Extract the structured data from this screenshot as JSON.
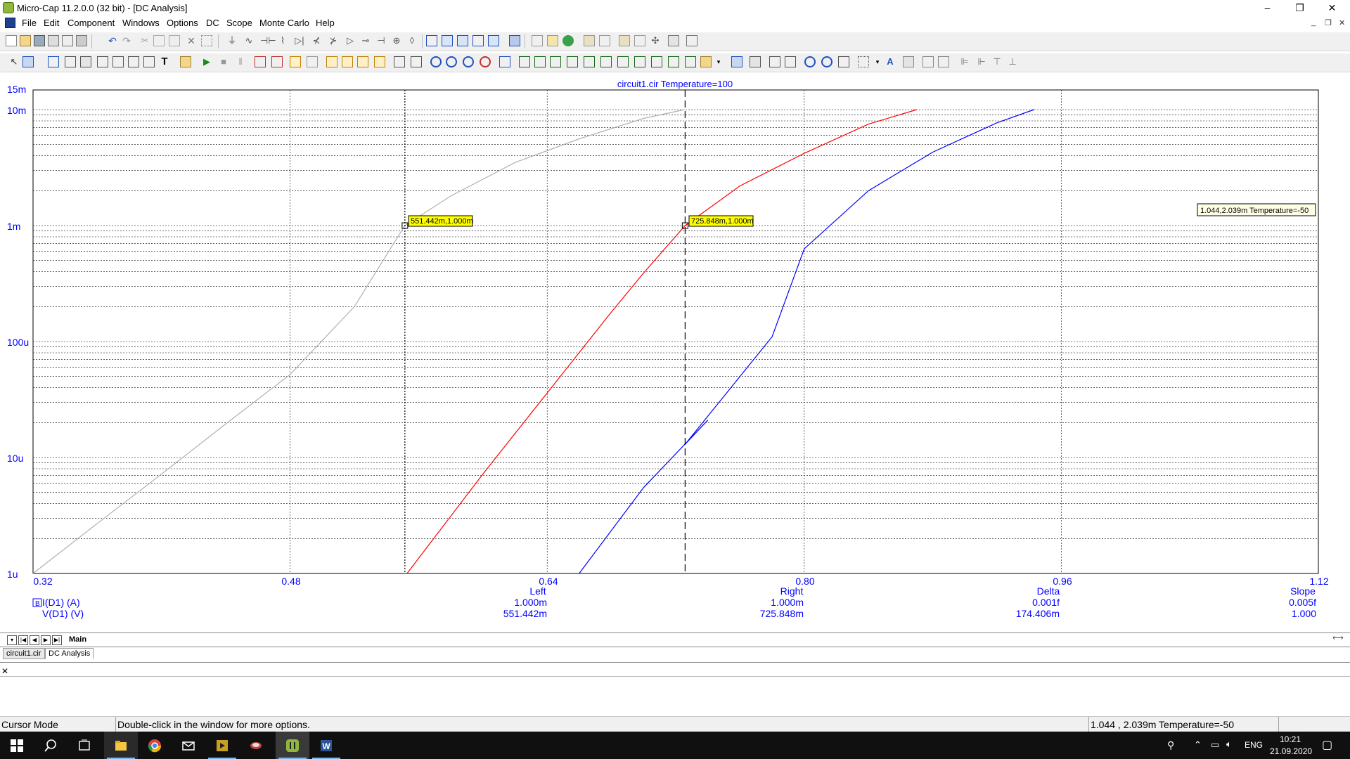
{
  "window": {
    "title": "Micro-Cap 11.2.0.0 (32 bit) - [DC Analysis]",
    "controls": [
      "–",
      "❐",
      "✕"
    ],
    "mdi_controls": [
      "_",
      "❐",
      "✕"
    ]
  },
  "menu": {
    "items": [
      "File",
      "Edit",
      "Component",
      "Windows",
      "Options",
      "DC",
      "Scope",
      "Monte Carlo",
      "Help"
    ]
  },
  "plot": {
    "title": "circuit1.cir Temperature=100",
    "y_ticks": [
      "15m",
      "10m",
      "1m",
      "100u",
      "10u",
      "1u"
    ],
    "x_ticks": [
      "0.32",
      "0.48",
      "0.64",
      "0.80",
      "0.96",
      "1.12"
    ],
    "cursor_left_label": "551.442m,1.000m",
    "cursor_right_label": "725.848m,1.000m",
    "tooltip": "1.044,2.039m Temperature=-50",
    "colors": {
      "axis_text": "#0000ff",
      "grid": "#000000",
      "label_bg": "#ffff00"
    }
  },
  "chart_data": {
    "type": "line",
    "title": "circuit1.cir Temperature=100",
    "xlabel": "V(D1) (V)",
    "ylabel": "I(D1) (A)",
    "y_scale": "log",
    "xlim": [
      0.32,
      1.12
    ],
    "ylim": [
      1e-06,
      0.015
    ],
    "x_ticks": [
      0.32,
      0.48,
      0.64,
      0.8,
      0.96,
      1.12
    ],
    "y_ticks": [
      1e-06,
      1e-05,
      0.0001,
      0.001,
      0.01,
      0.015
    ],
    "series": [
      {
        "color": "#b0b0b0",
        "x": [
          0.32,
          0.36,
          0.4,
          0.44,
          0.48,
          0.52,
          0.5514,
          0.58,
          0.62,
          0.66,
          0.7,
          0.7254
        ],
        "y": [
          1e-06,
          2.7e-06,
          7.2e-06,
          1.95e-05,
          5.2e-05,
          0.0002,
          0.001,
          0.0018,
          0.0035,
          0.0056,
          0.0084,
          0.01
        ]
      },
      {
        "color": "#ff0000",
        "x": [
          0.5528,
          0.6,
          0.64,
          0.68,
          0.7,
          0.725848,
          0.76,
          0.8,
          0.84,
          0.87
        ],
        "y": [
          1e-06,
          7.2e-06,
          3.6e-05,
          0.00018,
          0.00039,
          0.001,
          0.0022,
          0.0042,
          0.0075,
          0.01
        ]
      },
      {
        "color": "#0000ff",
        "x": [
          0.6599,
          0.7,
          0.74,
          0.7258,
          0.78,
          0.8,
          0.84,
          0.88,
          0.92,
          0.943
        ],
        "y": [
          1e-06,
          5.5e-06,
          2.1e-05,
          1.3e-05,
          0.00011,
          0.00063,
          0.002,
          0.0043,
          0.0077,
          0.01
        ]
      }
    ],
    "cursors": [
      {
        "name": "Left",
        "x": 0.551442,
        "style": "dotted"
      },
      {
        "name": "Right",
        "x": 0.725848,
        "style": "dashed"
      }
    ]
  },
  "readout": {
    "expr1": "I(D1) (A)",
    "expr2": "V(D1) (V)",
    "cols": [
      {
        "head": "Left",
        "v1": "1.000m",
        "v2": "551.442m"
      },
      {
        "head": "Right",
        "v1": "1.000m",
        "v2": "725.848m"
      },
      {
        "head": "Delta",
        "v1": "0.001f",
        "v2": "174.406m"
      },
      {
        "head": "Slope",
        "v1": "0.005f",
        "v2": "1.000"
      }
    ]
  },
  "tabs": {
    "page": "Main",
    "doc1": "circuit1.cir",
    "doc2": "DC Analysis"
  },
  "status": {
    "mode": "Cursor Mode",
    "hint": "Double-click in the window for more options.",
    "coords": "1.044 , 2.039m Temperature=-50"
  },
  "taskbar": {
    "lang": "ENG",
    "time": "10:21",
    "date": "21.09.2020"
  }
}
